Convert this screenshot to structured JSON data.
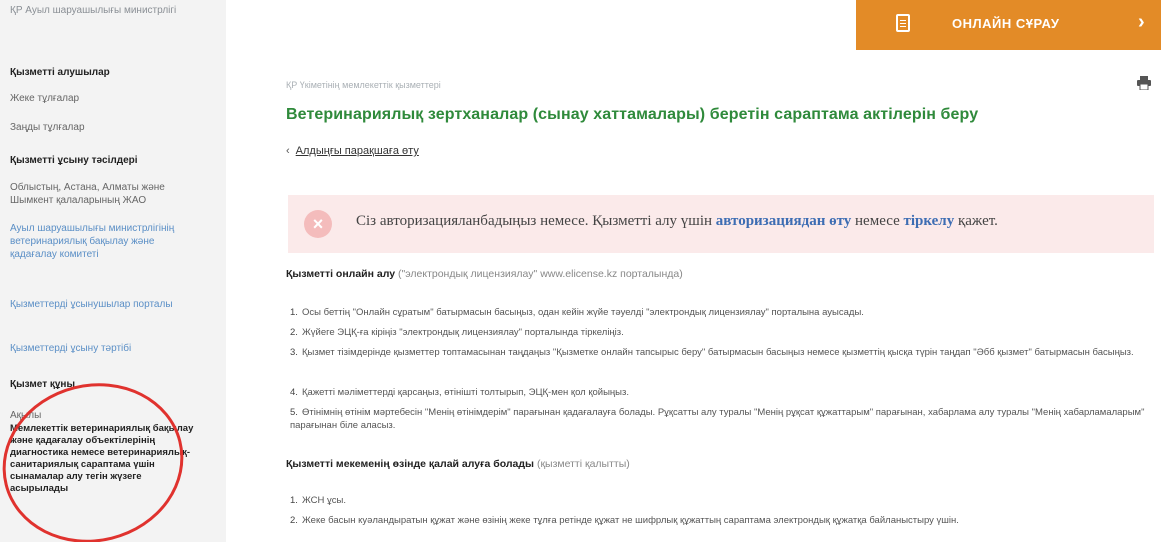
{
  "sidebar": {
    "top_text": "ҚР Ауыл шаруашылығы министрлігі",
    "consumers_heading": "Қызметті алушылар",
    "consumers": [
      "Жеке тұлғалар",
      "Заңды тұлғалар"
    ],
    "provision_heading": "Қызметті ұсыну тәсілдері",
    "provision_items": [
      "Облыстың, Астана, Алматы және Шымкент қалаларының ЖАО",
      "Ауыл шаруашылығы министрлігінің ветеринариялық бақылау және қадағалау комитеті",
      "Қызметтерді ұсынушылар порталы",
      "Қызметтерді ұсыну тәртібі"
    ],
    "cost_heading": "Қызмет құны",
    "cost_value": "Ақылы",
    "active_item": "Мемлекеттік ветеринариялық бақылау және қадағалау объектілерінің диагностика немесе ветеринариялық-санитариялық сараптама үшін сынамалар алу тегін жүзеге асырылады"
  },
  "header": {
    "online_button": "ОНЛАЙН СҰРАУ",
    "breadcrumb": "ҚР Үкіметінің мемлекеттік қызметтері"
  },
  "main": {
    "title": "Ветеринариялық зертханалар (сынау хаттамалары) беретін сараптама актілерін беру",
    "back_link": "Алдыңғы парақшаға өту",
    "alert": {
      "prefix": "Сіз авторизацияланбадыңыз немесе. Қызметті алу үшін ",
      "link1": "авторизациядан өту",
      "middle": " немесе ",
      "link2": "тіркелу",
      "suffix": " қажет."
    },
    "online_section": {
      "heading_bold": "Қызметті онлайн алу",
      "heading_rest": " (\"электрондық лицензиялау\" ",
      "heading_link": "www.elicense.kz",
      "heading_end": " порталында)"
    },
    "online_steps": [
      "Осы беттің \"Онлайн сұратым\" батырмасын басыңыз, одан кейін жүйе тәуелді \"электрондық лицензиялау\" порталына ауысады.",
      "Жүйеге ЭЦҚ-ға кіріңіз \"электрондық лицензиялау\" порталында тіркеліңіз.",
      "Қызмет тізімдерінде қызметтер топтамасынан таңдаңыз \"Қызметке онлайн тапсырыс беру\" батырмасын басыңыз немесе қызметтің қысқа түрін таңдап \"Әбб қызмет\" батырмасын басыңыз.",
      "Қажетті мәліметтерді қарсаңыз, өтінішті толтырып, ЭЦҚ-мен қол қойыңыз.",
      "Өтінімнің өтінім мәртебесін \"Менің өтінімдерім\" парағынан қадағалауға болады. Рұқсатты алу туралы \"Менің рұқсат құжаттарым\" парағынан, хабарлама алу туралы \"Менің хабарламаларым\" парағынан біле аласыз."
    ],
    "offline_section": {
      "heading_bold": "Қызметті мекеменің өзінде қалай алуға болады",
      "heading_rest": " (қызметті қалытты)"
    },
    "offline_steps": [
      "ЖСН ұсы.",
      "Жеке басын куәландыратын құжат және өзінің жеке тұлға ретінде құжат не шифрлық құжаттың сараптама электрондық құжатқа байланыстыру үшін."
    ]
  }
}
